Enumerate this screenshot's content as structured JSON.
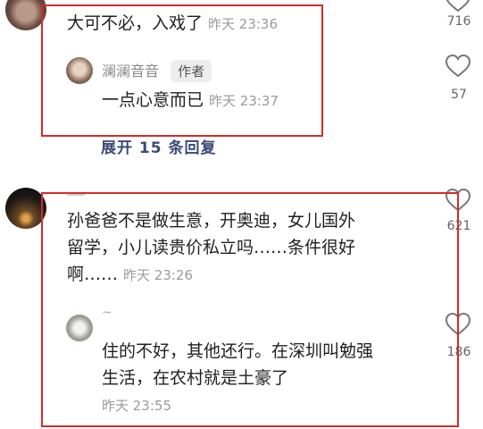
{
  "comment1": {
    "text": "大可不必，入戏了",
    "time": "昨天 23:36",
    "likes": "716",
    "reply": {
      "username": "澜澜音音",
      "badge": "作者",
      "text": "一点心意而已",
      "time": "昨天 23:37",
      "likes": "57"
    },
    "expand_label": "展开 15 条回复"
  },
  "comment2": {
    "lines": [
      "孙爸爸不是做生意，开奥迪，女儿国外",
      "留学，小儿读贵价私立吗……条件很好",
      "啊……"
    ],
    "time": "昨天 23:26",
    "likes": "621",
    "reply": {
      "username": "~",
      "lines": [
        "住的不好，其他还行。在深圳叫勉强",
        "生活，在农村就是土豪了"
      ],
      "time": "昨天 23:55",
      "likes": "186"
    }
  },
  "colors": {
    "highlight_box": "#d22c2c",
    "expand_link": "#3a4a78"
  },
  "icons": [
    "heart-icon"
  ]
}
